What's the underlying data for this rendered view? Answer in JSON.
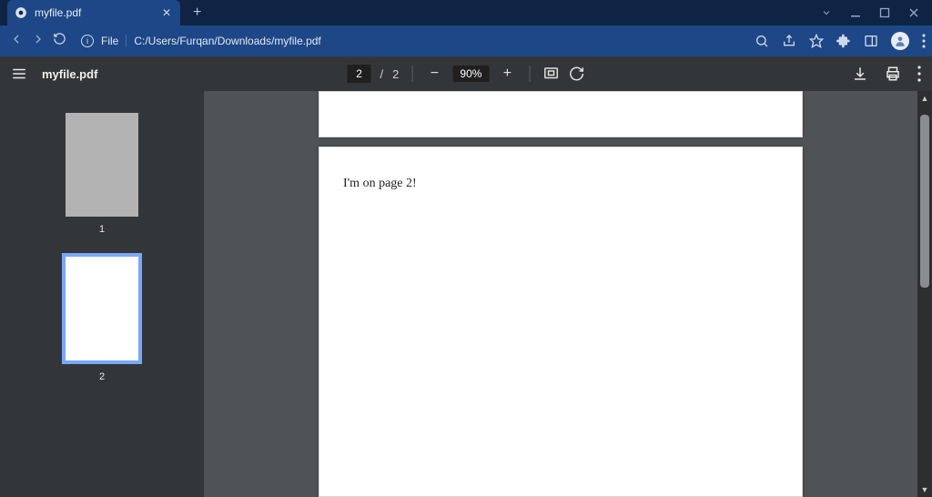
{
  "window": {
    "tab_title": "myfile.pdf",
    "new_tab_label": "+"
  },
  "addressbar": {
    "info_badge": "i",
    "protocol_label": "File",
    "url": "C:/Users/Furqan/Downloads/myfile.pdf"
  },
  "pdf_toolbar": {
    "filename": "myfile.pdf",
    "page_current": "2",
    "page_sep": "/",
    "page_total": "2",
    "zoom_level": "90%"
  },
  "thumbnails": {
    "page1_label": "1",
    "page2_label": "2"
  },
  "document": {
    "page2_text": "I'm on page  2!"
  }
}
